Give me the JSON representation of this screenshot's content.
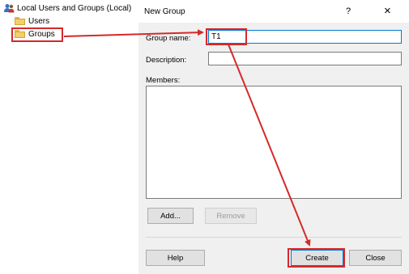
{
  "tree": {
    "root_label": "Local Users and Groups (Local)",
    "items": [
      {
        "label": "Users"
      },
      {
        "label": "Groups"
      }
    ]
  },
  "dialog": {
    "title": "New Group",
    "help_glyph": "?",
    "close_glyph": "×",
    "group_name_label": "Group name:",
    "group_name_value": "T1",
    "description_label": "Description:",
    "description_value": "",
    "members_label": "Members:",
    "add_label": "Add...",
    "remove_label": "Remove",
    "help_label": "Help",
    "create_label": "Create",
    "close_label": "Close"
  },
  "colors": {
    "annotation": "#d32a2a",
    "focus_border": "#0078d7"
  }
}
